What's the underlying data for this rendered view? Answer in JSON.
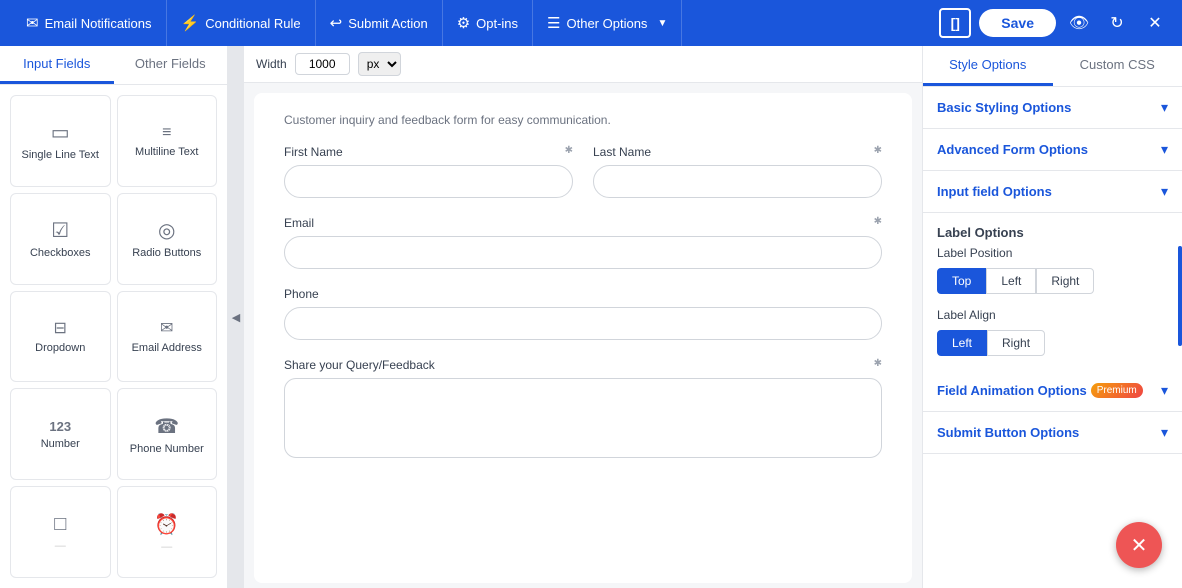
{
  "nav": {
    "items": [
      {
        "id": "email-notifications",
        "label": "Email Notifications",
        "icon": "✉"
      },
      {
        "id": "conditional-rule",
        "label": "Conditional Rule",
        "icon": "⚡"
      },
      {
        "id": "submit-action",
        "label": "Submit Action",
        "icon": "↩"
      },
      {
        "id": "opt-ins",
        "label": "Opt-ins",
        "icon": "⚙"
      },
      {
        "id": "other-options",
        "label": "Other Options",
        "icon": "☰",
        "has_arrow": true
      }
    ],
    "save_label": "Save",
    "bracket_label": "[]"
  },
  "left_panel": {
    "tabs": [
      {
        "id": "input-fields",
        "label": "Input Fields",
        "active": true
      },
      {
        "id": "other-fields",
        "label": "Other Fields",
        "active": false
      }
    ],
    "fields": [
      {
        "id": "single-line-text",
        "label": "Single Line Text",
        "icon": "▭"
      },
      {
        "id": "multiline-text",
        "label": "Multiline Text",
        "icon": "☰"
      },
      {
        "id": "checkboxes",
        "label": "Checkboxes",
        "icon": "☑"
      },
      {
        "id": "radio-buttons",
        "label": "Radio Buttons",
        "icon": "◎"
      },
      {
        "id": "dropdown",
        "label": "Dropdown",
        "icon": "⊟"
      },
      {
        "id": "email-address",
        "label": "Email Address",
        "icon": "✉"
      },
      {
        "id": "number",
        "label": "Number",
        "icon": "123"
      },
      {
        "id": "phone-number",
        "label": "Phone Number",
        "icon": "☎"
      },
      {
        "id": "more1",
        "label": "...",
        "icon": "□"
      },
      {
        "id": "more2",
        "label": "...",
        "icon": "⏰"
      }
    ]
  },
  "canvas": {
    "width_label": "Width",
    "width_value": "1000",
    "width_unit": "px",
    "form_desc": "Customer inquiry and feedback form for easy communication.",
    "fields": [
      {
        "id": "first-name",
        "label": "First Name",
        "required": true,
        "type": "input",
        "placeholder": ""
      },
      {
        "id": "last-name",
        "label": "Last Name",
        "required": true,
        "type": "input",
        "placeholder": ""
      },
      {
        "id": "email",
        "label": "Email",
        "required": true,
        "type": "input",
        "placeholder": ""
      },
      {
        "id": "phone",
        "label": "Phone",
        "required": false,
        "type": "input",
        "placeholder": ""
      },
      {
        "id": "query",
        "label": "Share your Query/Feedback",
        "required": true,
        "type": "textarea",
        "placeholder": ""
      }
    ]
  },
  "right_panel": {
    "tabs": [
      {
        "id": "style-options",
        "label": "Style Options",
        "active": true
      },
      {
        "id": "custom-css",
        "label": "Custom CSS",
        "active": false
      }
    ],
    "sections": [
      {
        "id": "basic-styling",
        "label": "Basic Styling Options",
        "expanded": false
      },
      {
        "id": "advanced-form",
        "label": "Advanced Form Options",
        "expanded": false
      },
      {
        "id": "input-field-options",
        "label": "Input field Options",
        "expanded": true
      }
    ],
    "label_options": {
      "title": "Label Options",
      "position_label": "Label Position",
      "position_buttons": [
        {
          "id": "top",
          "label": "Top",
          "active": true
        },
        {
          "id": "left",
          "label": "Left",
          "active": false
        },
        {
          "id": "right",
          "label": "Right",
          "active": false
        }
      ],
      "align_label": "Label Align",
      "align_buttons": [
        {
          "id": "left",
          "label": "Left",
          "active": true
        },
        {
          "id": "right",
          "label": "Right",
          "active": false
        }
      ]
    },
    "field_animation": {
      "label": "Field Animation Options",
      "badge": "Premium",
      "expanded": false
    },
    "submit_button": {
      "label": "Submit Button Options",
      "expanded": false
    }
  }
}
